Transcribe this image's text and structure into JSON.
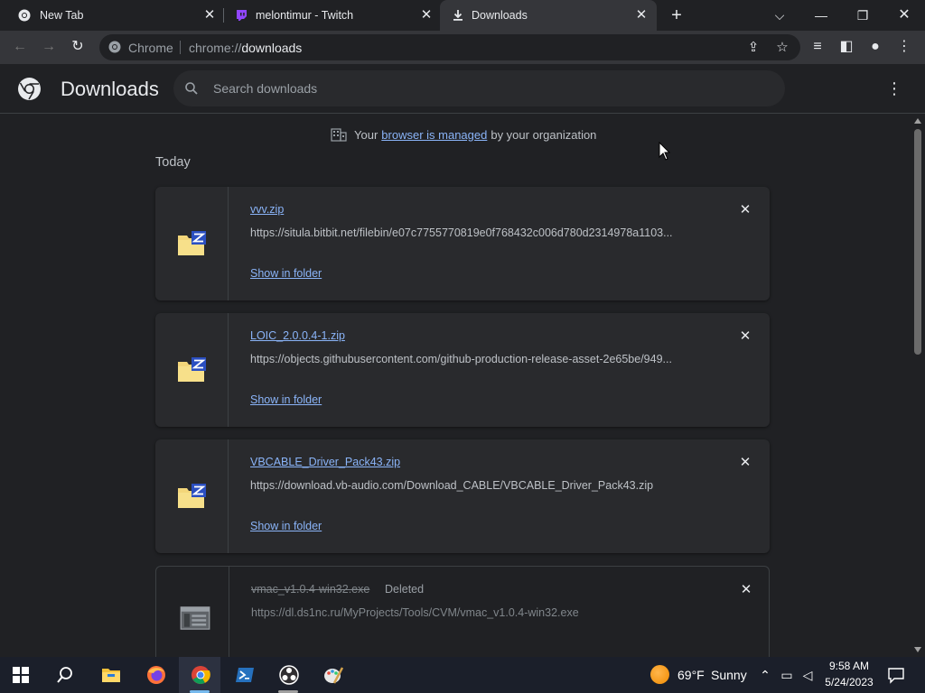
{
  "tabs": [
    {
      "title": "New Tab",
      "favicon": "chrome-icon"
    },
    {
      "title": "melontimur - Twitch",
      "favicon": "twitch-icon"
    },
    {
      "title": "Downloads",
      "favicon": "download-icon",
      "active": true
    }
  ],
  "omnibox": {
    "scheme_label": "Chrome",
    "url_prefix": "chrome://",
    "url_path": "downloads"
  },
  "page": {
    "title": "Downloads",
    "search_placeholder": "Search downloads",
    "managed_prefix": "Your",
    "managed_link": "browser is managed",
    "managed_suffix": "by your organization",
    "date_group": "Today"
  },
  "downloads": [
    {
      "name": "vvv.zip",
      "url": "https://situla.bitbit.net/filebin/e07c7755770819e0f768432c006d780d2314978a1103...",
      "action": "Show in folder",
      "icon": "zip-folder-icon"
    },
    {
      "name": "LOIC_2.0.0.4-1.zip",
      "url": "https://objects.githubusercontent.com/github-production-release-asset-2e65be/949...",
      "action": "Show in folder",
      "icon": "zip-folder-icon"
    },
    {
      "name": "VBCABLE_Driver_Pack43.zip",
      "url": "https://download.vb-audio.com/Download_CABLE/VBCABLE_Driver_Pack43.zip",
      "action": "Show in folder",
      "icon": "zip-folder-icon"
    },
    {
      "name": "vmac_v1.0.4-win32.exe",
      "status": "Deleted",
      "url": "https://dl.ds1nc.ru/MyProjects/Tools/CVM/vmac_v1.0.4-win32.exe",
      "icon": "exe-file-icon"
    }
  ],
  "taskbar": {
    "weather_temp": "69°F",
    "weather_condition": "Sunny",
    "time": "9:58 AM",
    "date": "5/24/2023",
    "apps": [
      "start-icon",
      "search-icon",
      "file-explorer-icon",
      "firefox-icon",
      "chrome-icon",
      "powershell-icon",
      "obs-icon",
      "paint-icon"
    ]
  },
  "colors": {
    "background": "#202124",
    "card": "#292a2d",
    "link": "#8ab4f8",
    "taskbar": "#1b1f2a"
  }
}
